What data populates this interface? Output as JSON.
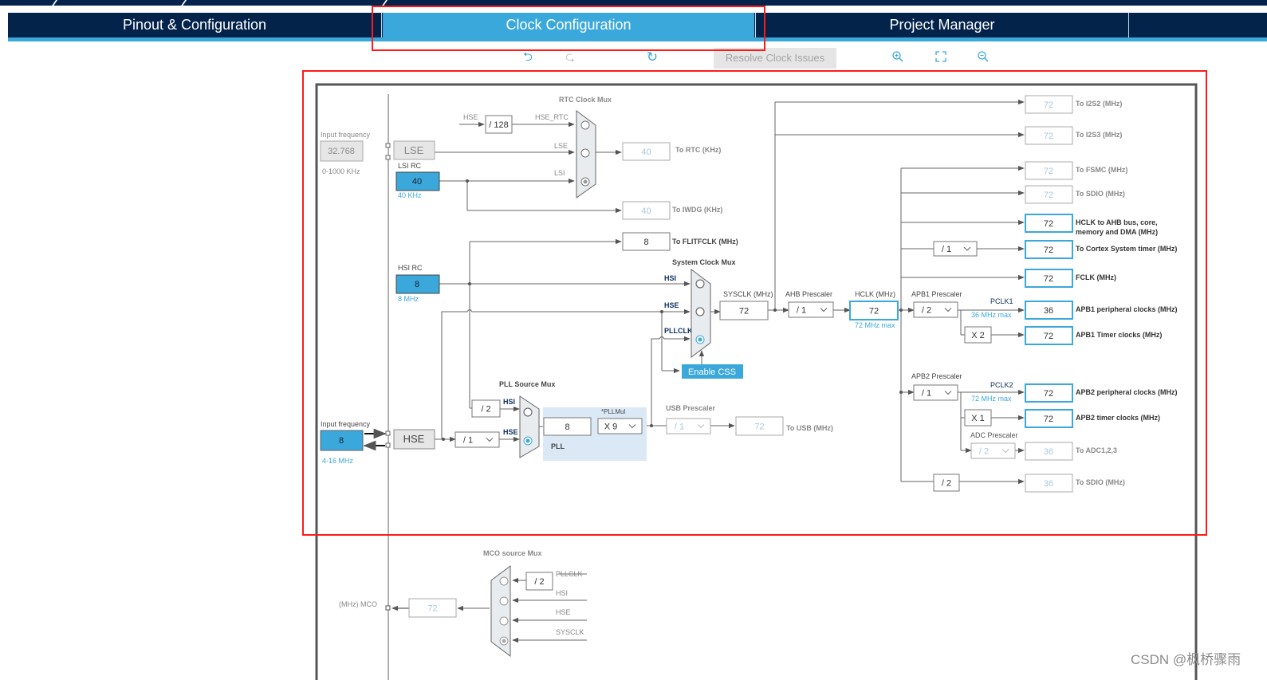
{
  "tabs": [
    {
      "label": "Pinout & Configuration",
      "active": false
    },
    {
      "label": "Clock Configuration",
      "active": true
    },
    {
      "label": "Project Manager",
      "active": false
    },
    {
      "label": "",
      "active": false
    }
  ],
  "toolbar": {
    "undo_icon": "undo-icon",
    "redo_icon": "redo-icon",
    "reset_icon": "refresh-icon",
    "resolve_label": "Resolve Clock Issues",
    "zoom_in_icon": "zoom-in-icon",
    "fit_icon": "fit-to-screen-icon",
    "zoom_out_icon": "zoom-out-icon"
  },
  "colors": {
    "nav_dark": "#03234b",
    "accent": "#3ba8dc",
    "highlight_frame": "#ff1a1a",
    "disabled_text": "#a8c8e0",
    "pll_bg": "#dbe9f6"
  },
  "diagram": {
    "lse": {
      "input_label": "Input frequency",
      "input_value": "32.768",
      "range": "0-1000 KHz",
      "block_label": "LSE"
    },
    "lsi": {
      "title": "LSI RC",
      "value": "40",
      "freq": "40 KHz"
    },
    "rtc_mux": {
      "title": "RTC Clock Mux",
      "hse_label": "HSE",
      "div_label": "/ 128",
      "hse_rtc_label": "HSE_RTC",
      "lse_label": "LSE",
      "lsi_label": "LSI",
      "selected": "LSI"
    },
    "to_rtc": {
      "value": "40",
      "label": "To RTC (KHz)"
    },
    "to_iwdg": {
      "value": "40",
      "label": "To IWDG (KHz)"
    },
    "to_flitfclk": {
      "value": "8",
      "label": "To FLITFCLK (MHz)"
    },
    "hsi": {
      "title": "HSI RC",
      "value": "8",
      "freq": "8 MHz"
    },
    "sys_mux": {
      "title": "System Clock Mux",
      "inputs": [
        "HSI",
        "HSE",
        "PLLCLK"
      ],
      "selected": "PLLCLK",
      "css_label": "Enable CSS"
    },
    "sysclk": {
      "label": "SYSCLK (MHz)",
      "value": "72"
    },
    "ahb": {
      "label": "AHB Prescaler",
      "value": "/ 1"
    },
    "hclk": {
      "label": "HCLK (MHz)",
      "value": "72",
      "max": "72 MHz max"
    },
    "apb1": {
      "label": "APB1 Prescaler",
      "value": "/ 2",
      "pclk": "PCLK1",
      "max": "36 MHz max",
      "timer_mult": "X 2"
    },
    "apb2": {
      "label": "APB2 Prescaler",
      "value": "/ 1",
      "pclk": "PCLK2",
      "max": "72 MHz max",
      "timer_mult": "X 1"
    },
    "adc": {
      "label": "ADC Prescaler",
      "value": "/ 2"
    },
    "cortex_div": "/ 1",
    "sdio_div": "/ 2",
    "hse": {
      "input_label": "Input frequency",
      "input_value": "8",
      "range": "4-16 MHz",
      "block_label": "HSE",
      "div": "/ 1"
    },
    "pll_src_mux": {
      "title": "PLL Source Mux",
      "hsi_div": "/ 2",
      "inputs": [
        "HSI",
        "HSE"
      ],
      "selected": "HSE"
    },
    "pll": {
      "label": "PLL",
      "value": "8",
      "mul_label": "*PLLMul",
      "mul_value": "X 9"
    },
    "usb": {
      "label": "USB Prescaler",
      "value": "/ 1",
      "out_value": "72",
      "out_label": "To USB (MHz)"
    },
    "outputs": [
      {
        "value": "72",
        "label": "To I2S2 (MHz)",
        "active": false
      },
      {
        "value": "72",
        "label": "To I2S3 (MHz)",
        "active": false
      },
      {
        "value": "72",
        "label": "To FSMC (MHz)",
        "active": false
      },
      {
        "value": "72",
        "label": "To SDIO (MHz)",
        "active": false
      },
      {
        "value": "72",
        "label": "HCLK to AHB bus, core,",
        "label2": "memory and DMA (MHz)",
        "active": true
      },
      {
        "value": "72",
        "label": "To Cortex System timer (MHz)",
        "active": true
      },
      {
        "value": "72",
        "label": "FCLK (MHz)",
        "active": true
      },
      {
        "value": "36",
        "label": "APB1 peripheral clocks (MHz)",
        "active": true
      },
      {
        "value": "72",
        "label": "APB1 Timer clocks (MHz)",
        "active": true
      },
      {
        "value": "72",
        "label": "APB2 peripheral clocks (MHz)",
        "active": true
      },
      {
        "value": "72",
        "label": "APB2 timer clocks (MHz)",
        "active": true
      },
      {
        "value": "36",
        "label": "To ADC1,2,3",
        "active": false
      },
      {
        "value": "36",
        "label": "To SDIO (MHz)",
        "active": false
      }
    ],
    "mco": {
      "title": "MCO source Mux",
      "label": "(MHz) MCO",
      "value": "72",
      "pll_div": "/ 2",
      "inputs": [
        "PLLCLK",
        "HSI",
        "HSE",
        "SYSCLK"
      ],
      "selected": "SYSCLK"
    }
  },
  "watermark": "CSDN @枫桥骤雨"
}
